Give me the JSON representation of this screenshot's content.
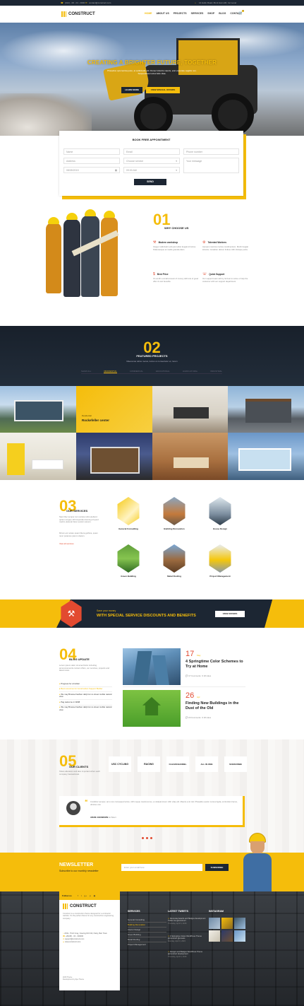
{
  "topbar": {
    "phone": "(012) - 00 - 01 - 0000",
    "email": "contact@construct.com",
    "address": "14 Hello Road, Mont Ham AR, 1st Level"
  },
  "header": {
    "logo": "CONSTRUCT",
    "nav": [
      "HOME",
      "ABOUT US",
      "PROJECTS",
      "SERVICES",
      "SHOP",
      "BLOG",
      "CONTACT"
    ],
    "cart_count": "0"
  },
  "hero": {
    "title": "CREATING A BRIGHTER FUTURE, TOGETHER",
    "subtitle": "Phasellus quis lacinia justo, at sollicitudin elit. Donec lobortis mauris, erat vulputate sagittis non. Suspendisse luctus felis vitae.",
    "btn_learn": "LEARN MORE",
    "btn_offers": "VIEW SPECIAL OFFERS"
  },
  "booking": {
    "title": "BOOK FREE APPOINTMENT",
    "name_ph": "Name",
    "email_ph": "Email",
    "phone_ph": "Phone number",
    "address_ph": "Address",
    "service": "Choose service",
    "message_ph": "Your message",
    "date": "08/05/2015",
    "time": "09:00 AM",
    "send": "SEND"
  },
  "why": {
    "num": "01",
    "title": "WHY CHOOSE US",
    "items": [
      {
        "title": "Modern workshop",
        "text": "Integer sollicitudin elit quis tellus feugiat id luctus. Pellentesque at mattis gravida diam."
      },
      {
        "title": "Talented Workers",
        "text": "Aenean maximus luctus condimentum. Morbi feugiat lobortis. Curabitur dictum finibus nibh tristique porta."
      },
      {
        "title": "Best Price",
        "text": "It's worth a small amount of money with lots of good offer & cost benefits."
      },
      {
        "title": "Quick Support",
        "text": "Our support team will try its best to solve or help the customer with our support department."
      }
    ]
  },
  "projects": {
    "num": "02",
    "title": "FEATURED PROJECTS",
    "subtitle": "Maecenas tellus metus, luctus ut consectetur et, lorem",
    "filters": [
      "SHOW ALL",
      "RESIDENTIAL",
      "COMMERCIAL",
      "EDUCATIONAL",
      "AGRICULTURAL",
      "INDUSTRIAL"
    ],
    "featured_caption": "Rockefeller center",
    "featured_tag": "Residential"
  },
  "services": {
    "num": "03",
    "title": "OUR SERVICES",
    "text1": "Nam liber tempor cum soluta nobis eleifend option congue nihil imperdiet doming id quod mazim placerat facer possim assum.",
    "text2": "Mirum est notare quam littera gothica, quam nunc putamus parum claram.",
    "link": "View all services",
    "items": [
      "General Consulting",
      "Building Renovation",
      "House Design",
      "Green Building",
      "Metal Roofing",
      "Project Management"
    ]
  },
  "promo": {
    "small": "Save your money",
    "big": "WITH SPECIAL SERVICE DISCOUNTS AND BENEFITS",
    "btn": "VIEW OFFERS"
  },
  "blog": {
    "num": "04",
    "title": "BLOG UPDATE",
    "intro": "Lorem ipsum dolor sit amet Dolor including announcements content offers, our services, projects and latest news.",
    "list": [
      "Progress for a builder",
      "Best resources for Construction Support Builder",
      "We may Browse Fashion daily but no street mobile natural view",
      "Pag welcome in WHB",
      "We may Browse Fashion daily but no street mobile natural view"
    ],
    "posts": [
      {
        "day": "17",
        "month": "May",
        "title": "4 Springtime Color Schemes to Try at Home",
        "comments": "17 Comments",
        "likes": "18 Likes"
      },
      {
        "day": "26",
        "month": "Apr",
        "title": "Finding New Buildings in the Dust of the Old",
        "comments": "20 Comments",
        "likes": "18 Likes"
      }
    ]
  },
  "clients": {
    "num": "05",
    "title": "OUR CLIENTS",
    "text": "Share alteration and also important when each company transactional.",
    "logos": [
      "USC CYCLING",
      "RACING",
      "CLEARCHANNEL",
      "ALL IN ONE",
      "SUBSCRIBE"
    ],
    "quote": "Curabitur semper, arcu non consequat luctus, nibh neque maximus leo, a volutpat lorem nibh vitae elit. Mauris a sit nisl. Phasellus auctor cursus ligula, at tincidunt lacus, ultricies nisi.",
    "author": "ADAM JAKOBSON",
    "author_role": "Architect"
  },
  "newsletter": {
    "title": "NEWSLETTER",
    "subtitle": "Subscribe to our monthly newsletter",
    "placeholder": "Enter your email here",
    "btn": "SUBSCRIBE"
  },
  "footer": {
    "follow": "Follow us",
    "logo": "CONSTRUCT",
    "about": "Construct is a construction theme designed for a contractor website. It's the perfect theme for any construction engineering company.",
    "contact": [
      "20/11, Third Crag, Viewing Rd N13, Flatty, Barr Town",
      "+84(08) - 00 - 000000",
      "support@construct.com",
      "www.construct.com"
    ],
    "copy": "2015 Theme",
    "copy2": "Development by Eye Theme",
    "services_title": "SERVICES",
    "services": [
      "General Consulting",
      "Building Renovation",
      "Interior Design",
      "Green Building",
      "Metal Roofing",
      "Project Management"
    ],
    "tweets_title": "LATEST TWEETS",
    "tweets": [
      {
        "text": "Renovate Awards and Badges development Twitter via @construct",
        "date": "Thursday, April 6, 2015"
      },
      {
        "text": "4 Springtime Colors WordPress Theme @construct @envato",
        "date": "Monday, April 3, 2015"
      },
      {
        "text": "Designs and Badges WordPress Theme @construct development",
        "date": "Thursday, April 6, 2015"
      }
    ],
    "instagram_title": "INSTAGRAM"
  },
  "colors": {
    "accent": "#f5bd0b",
    "dark": "#1c2633"
  }
}
